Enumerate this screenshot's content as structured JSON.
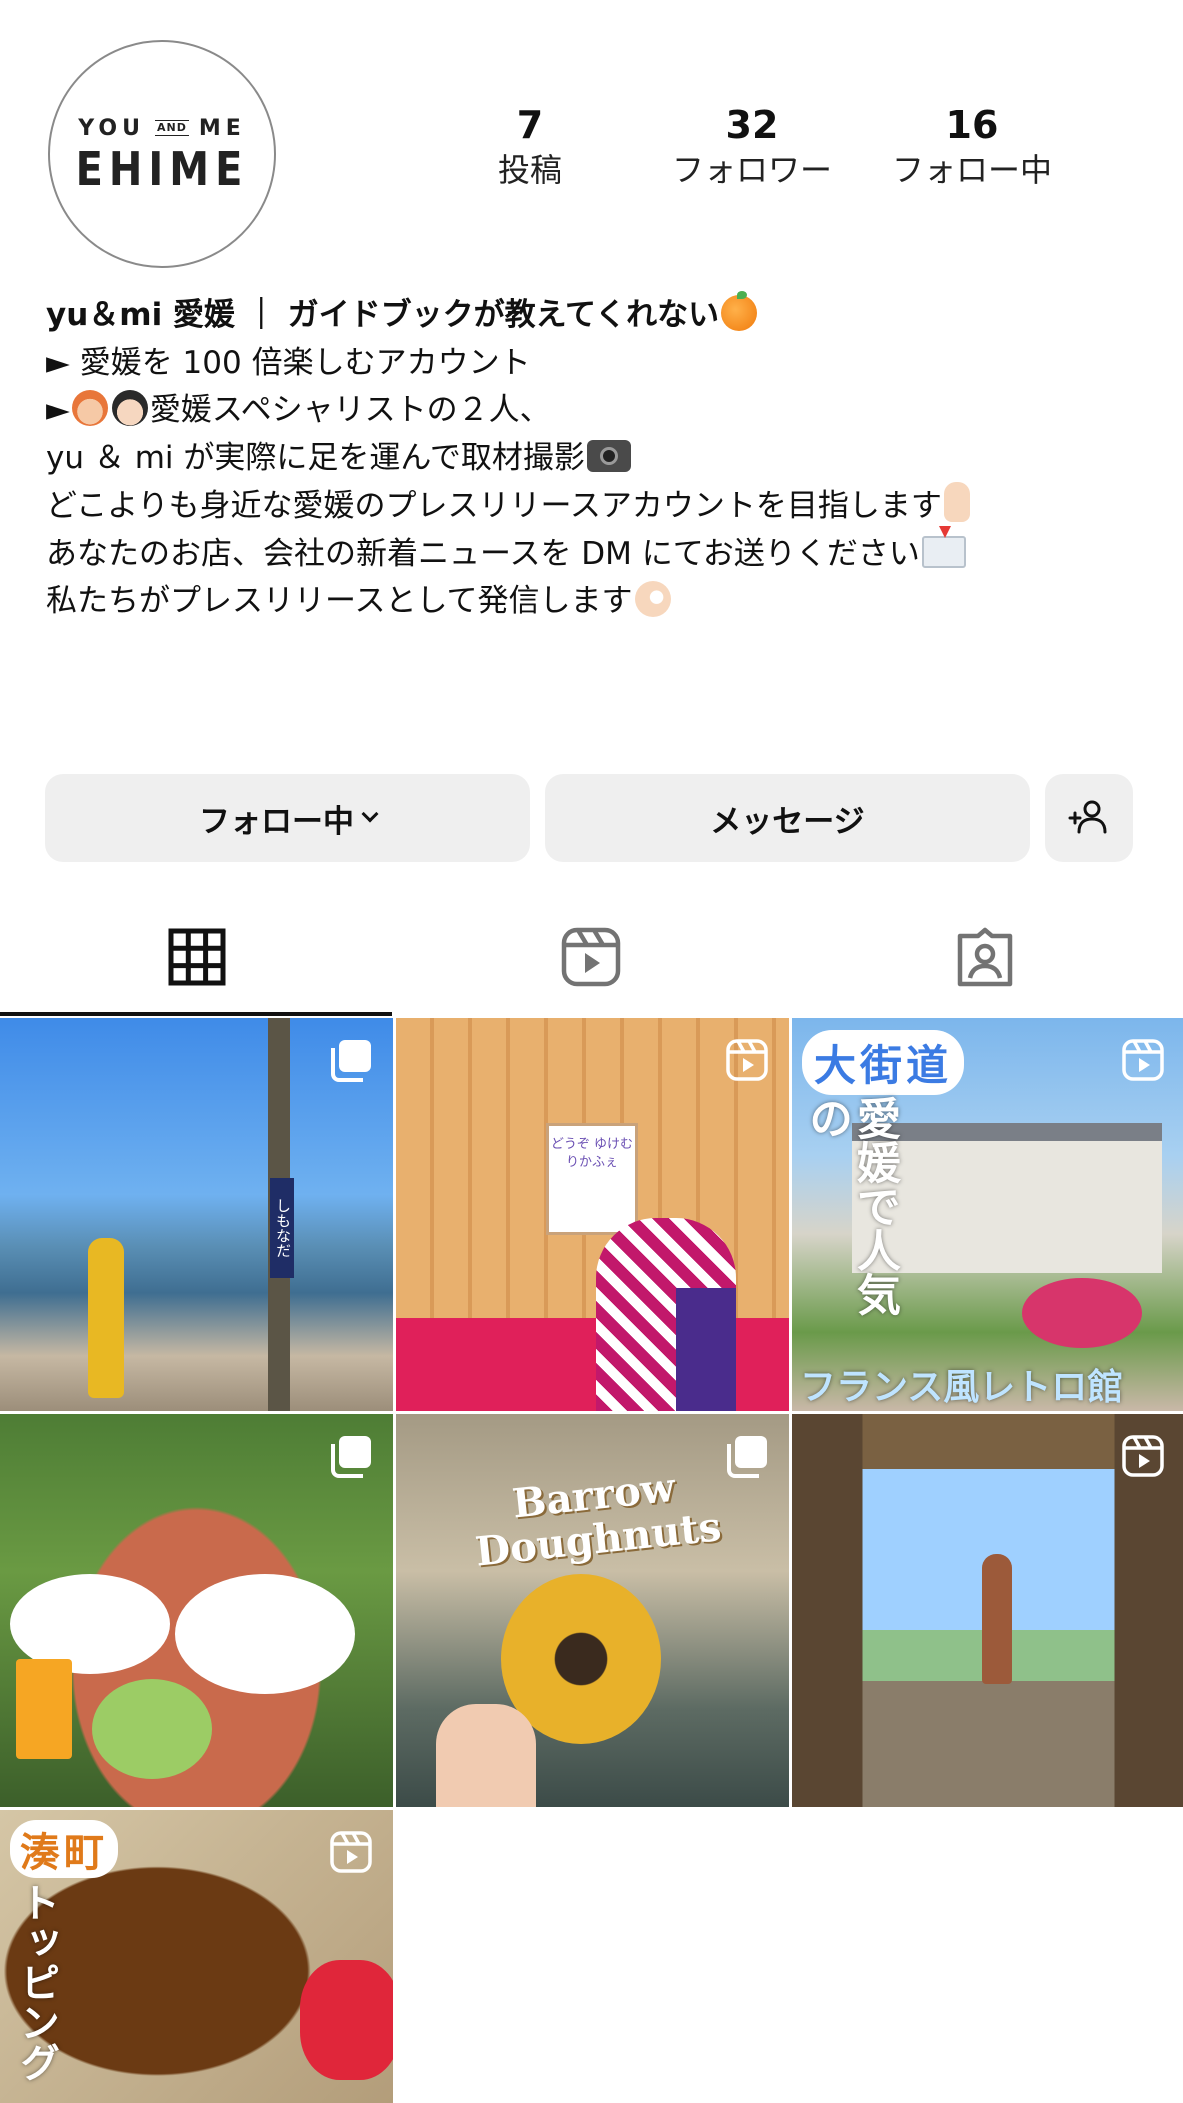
{
  "profile": {
    "logo_line1_left": "YOU",
    "logo_and": "AND",
    "logo_line1_right": "ME",
    "logo_line2": "EHIME"
  },
  "stats": [
    {
      "count": "7",
      "label": "投稿"
    },
    {
      "count": "32",
      "label": "フォロワー"
    },
    {
      "count": "16",
      "label": "フォロー中"
    }
  ],
  "bio": {
    "name": "yu＆mi 愛媛 ｜ ガイドブックが教えてくれない",
    "line1": "► 愛媛を 100 倍楽しむアカウント",
    "line2_prefix": "►",
    "line2": "愛媛スペシャリストの２人、",
    "line3": "yu ＆ mi が実際に足を運んで取材撮影",
    "line4": "どこよりも身近な愛媛のプレスリリースアカウントを目指します",
    "line5": "あなたのお店、会社の新着ニュースを DM にてお送りください",
    "line6": "私たちがプレスリリースとして発信します"
  },
  "buttons": {
    "following": "フォロー中",
    "message": "メッセージ"
  },
  "posts": [
    {
      "type": "carousel",
      "overlay": "しもなだ"
    },
    {
      "type": "reel",
      "overlay": "どうぞ ゆけむりかふぇ"
    },
    {
      "type": "reel",
      "overlay_badge": "大街道",
      "overlay_title": "愛媛で人気の",
      "overlay_sub": "フランス風レトロ館"
    },
    {
      "type": "carousel"
    },
    {
      "type": "carousel",
      "overlay": "Barrow Doughnuts"
    },
    {
      "type": "reel"
    },
    {
      "type": "reel",
      "overlay_badge": "湊町",
      "overlay_title": "トッピング"
    }
  ],
  "colors": {
    "button_bg": "#efefef",
    "text": "#111111",
    "icon_gray": "#737373"
  }
}
